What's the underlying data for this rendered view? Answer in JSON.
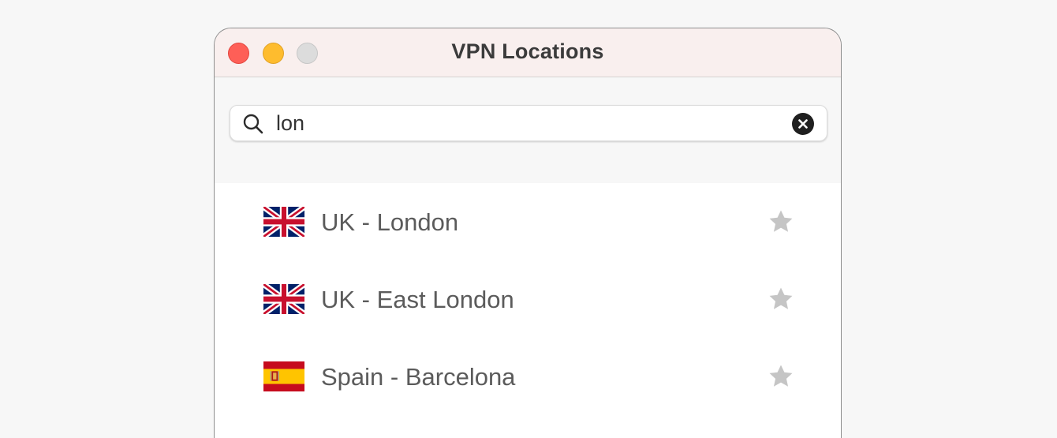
{
  "window": {
    "title": "VPN Locations"
  },
  "search": {
    "value": "lon",
    "icon": "search-icon",
    "clear_icon": "clear-icon"
  },
  "locations": [
    {
      "label": "UK - London",
      "flag": "uk",
      "favorite_icon": "star-icon",
      "favorited": false
    },
    {
      "label": "UK - East London",
      "flag": "uk",
      "favorite_icon": "star-icon",
      "favorited": false
    },
    {
      "label": "Spain - Barcelona",
      "flag": "spain",
      "favorite_icon": "star-icon",
      "favorited": false
    }
  ],
  "colors": {
    "close": "#fe5f57",
    "minimize": "#febc2e",
    "maximize_disabled": "#dcdcdc",
    "star": "#c5c5c5",
    "uk_blue": "#012169",
    "uk_red": "#c8102e",
    "spain_red": "#c60b1e",
    "spain_yellow": "#ffc400"
  }
}
